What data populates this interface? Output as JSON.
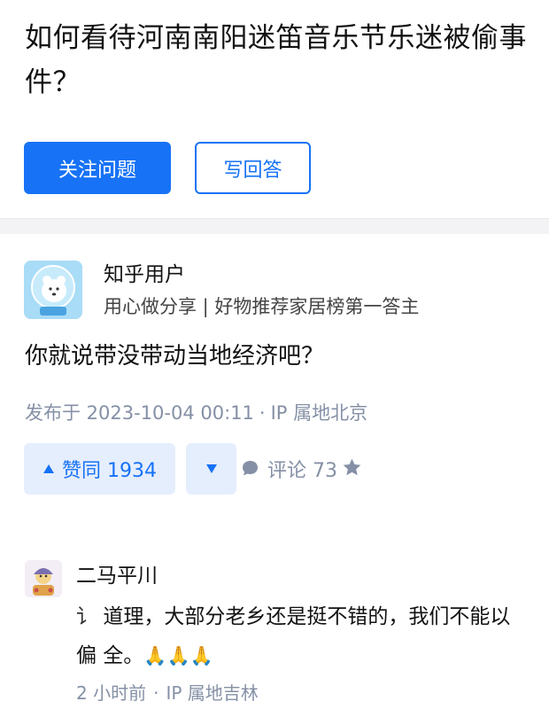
{
  "question": {
    "title": "如何看待河南南阳迷笛音乐节乐迷被偷事件？",
    "follow_label": "关注问题",
    "answer_label": "写回答"
  },
  "answer": {
    "author_name": "知乎用户",
    "author_bio": "用心做分享 | 好物推荐家居榜第一答主",
    "text": "你就说带没带动当地经济吧？",
    "published": "发布于 2023-10-04 00:11",
    "separator": "·",
    "ip": "IP 属地北京",
    "vote_up_label": "赞同 1934",
    "comment_label": "评论 73"
  },
  "comment": {
    "author_name": "二马平川",
    "prefix": "讠",
    "text": "道理，大部分老乡还是挺不错的，我们不能以偏 全。",
    "emojis": "🙏🙏🙏",
    "time": "2 小时前",
    "separator": "·",
    "ip": "IP 属地吉林"
  },
  "icons": {
    "vote_up": "triangle-up-icon",
    "vote_down": "triangle-down-icon",
    "comment": "comment-bubble-icon",
    "favorite": "star-icon"
  },
  "colors": {
    "accent": "#1772f6",
    "vote_bg": "#e5eefd",
    "meta_text": "#8590a6"
  }
}
